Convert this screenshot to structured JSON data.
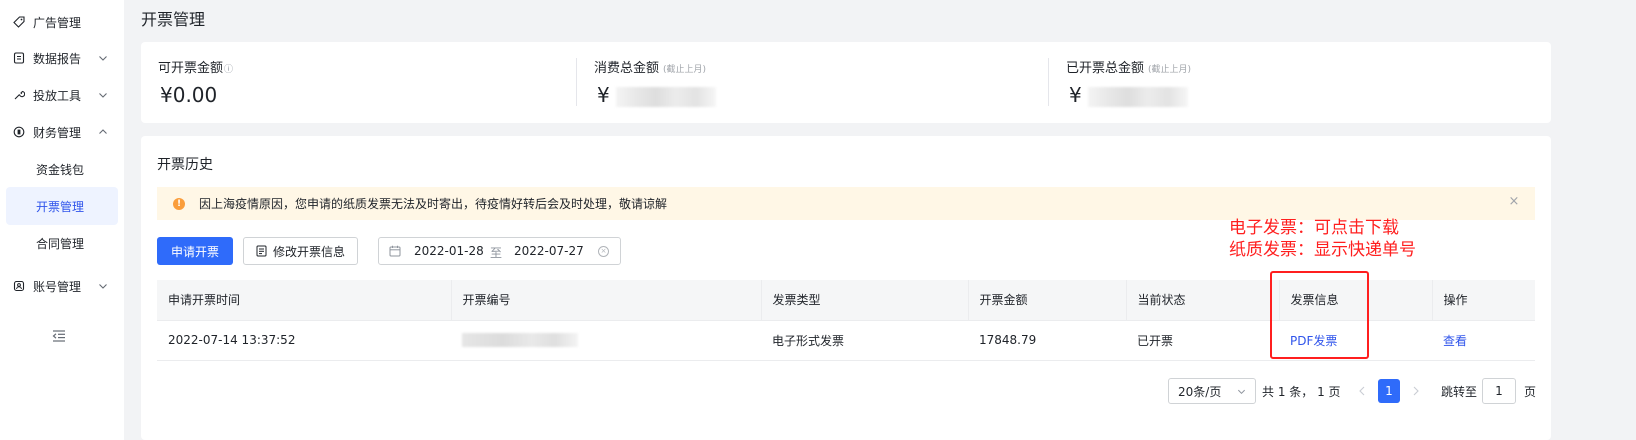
{
  "sidebar": {
    "items": [
      {
        "label": "广告管理",
        "icon": "tag-icon"
      },
      {
        "label": "数据报告",
        "icon": "report-icon"
      },
      {
        "label": "投放工具",
        "icon": "tool-icon"
      },
      {
        "label": "财务管理",
        "icon": "finance-icon"
      },
      {
        "label": "账号管理",
        "icon": "account-icon"
      }
    ],
    "finance_sub": [
      "资金钱包",
      "开票管理",
      "合同管理"
    ],
    "active_sub": "开票管理"
  },
  "page": {
    "title": "开票管理"
  },
  "stats": {
    "available": {
      "label": "可开票金额",
      "value": "¥0.00"
    },
    "consumed": {
      "label": "消费总金额",
      "note": "(截止上月)",
      "currency": "¥"
    },
    "issued": {
      "label": "已开票总金额",
      "note": "(截止上月)",
      "currency": "¥"
    }
  },
  "history": {
    "title": "开票历史",
    "notice": "因上海疫情原因，您申请的纸质发票无法及时寄出，待疫情好转后会及时处理，敬请谅解",
    "apply_button": "申请开票",
    "edit_button": "修改开票信息",
    "date_from": "2022-01-28",
    "date_sep": "至",
    "date_to": "2022-07-27",
    "columns": [
      "申请开票时间",
      "开票编号",
      "发票类型",
      "开票金额",
      "当前状态",
      "发票信息",
      "操作"
    ],
    "rows": [
      {
        "time": "2022-07-14 13:37:52",
        "type": "电子形式发票",
        "amount": "17848.79",
        "status": "已开票",
        "info": "PDF发票",
        "action": "查看"
      }
    ]
  },
  "pagination": {
    "page_size": "20条/页",
    "total": "共 1 条，  1 页",
    "current": "1",
    "jump_label": "跳转至",
    "jump_value": "1",
    "jump_suffix": "页"
  },
  "annotation": {
    "line1": "电子发票：可点击下载",
    "line2": "纸质发票：显示快递单号",
    "color": "#ff1f1f"
  },
  "colors": {
    "primary": "#2f6bfa",
    "link": "#2f54eb",
    "warning_bg": "#fff7e6",
    "warning_icon": "#fa9d3b",
    "active_nav_bg": "#eef3ff"
  }
}
